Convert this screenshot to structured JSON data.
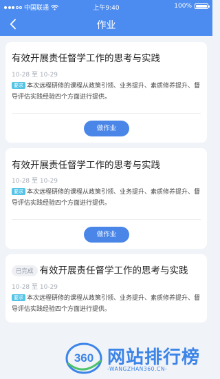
{
  "status": {
    "carrier": "中国联通",
    "time": "上午9:40",
    "battery": "100%",
    "battery_level": 1.0
  },
  "nav": {
    "title": "作业"
  },
  "assignments": [
    {
      "title": "有效开展责任督学工作的思考与实践",
      "date": "10-28 至 10-29",
      "tag": "要求",
      "desc": "本次远程研修的课程从政策引领、业务提升、素质修养提升、督导评估实践经验四个方面进行提供。",
      "button": "做作业"
    },
    {
      "title": "有效开展责任督学工作的思考与实践",
      "date": "10-28 至 10-29",
      "tag": "要求",
      "desc": "本次远程研修的课程从政策引领、业务提升、素质修养提升、督导评估实践经验四个方面进行提供。",
      "button": "做作业"
    },
    {
      "status_badge": "已完成",
      "title": "有效开展责任督学工作的思考与实践",
      "date": "10-28 至 10-29",
      "tag": "要求",
      "desc": "本次远程研修的课程从政策引领、业务提升、素质修养提升、督导评估实践经验四个方面进行提供。"
    }
  ],
  "watermark": {
    "logo_number": "360",
    "name": "网站排行榜",
    "url": "-WANGZHAN360.CN-"
  },
  "colors": {
    "brand_blue": "#4c8cf0",
    "button_blue": "#4a86e8",
    "tag_cyan": "#53c3e6",
    "background": "#f0f3f7"
  }
}
